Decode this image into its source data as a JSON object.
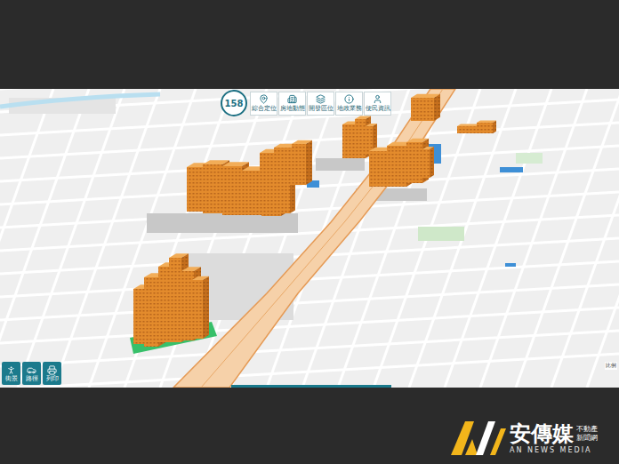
{
  "toolbar": {
    "logo": "158",
    "items": [
      {
        "label": "綜合定位",
        "icon": "pin"
      },
      {
        "label": "房地動態",
        "icon": "building"
      },
      {
        "label": "開發區位",
        "icon": "layers"
      },
      {
        "label": "地政業務",
        "icon": "info"
      },
      {
        "label": "便民資訊",
        "icon": "user"
      }
    ]
  },
  "tools": [
    {
      "label": "街景",
      "icon": "person"
    },
    {
      "label": "路徑",
      "icon": "car"
    },
    {
      "label": "列印",
      "icon": "printer"
    }
  ],
  "scale": {
    "label": "比例"
  },
  "watermark": {
    "name": "安傳媒",
    "tagline": [
      "不動產",
      "新聞網"
    ],
    "english": "AN NEWS MEDIA"
  }
}
